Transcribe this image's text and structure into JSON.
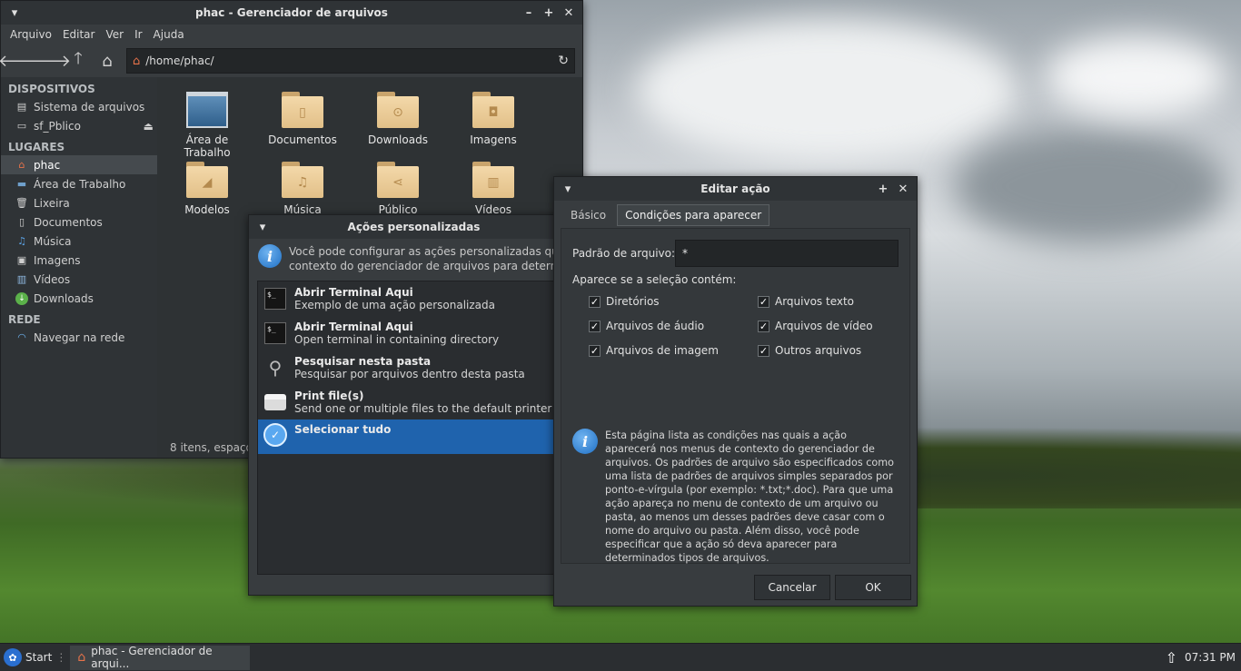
{
  "file_manager": {
    "title": "phac - Gerenciador de arquivos",
    "menu": [
      "Arquivo",
      "Editar",
      "Ver",
      "Ir",
      "Ajuda"
    ],
    "path": "/home/phac/",
    "sidebar": {
      "devices_header": "DISPOSITIVOS",
      "devices": [
        "Sistema de arquivos",
        "sf_Pblico"
      ],
      "places_header": "LUGARES",
      "places": [
        "phac",
        "Área de Trabalho",
        "Lixeira",
        "Documentos",
        "Música",
        "Imagens",
        "Vídeos",
        "Downloads"
      ],
      "network_header": "REDE",
      "network": [
        "Navegar na rede"
      ]
    },
    "items": [
      "Área de Trabalho",
      "Documentos",
      "Downloads",
      "Imagens",
      "Modelos",
      "Música",
      "Público",
      "Vídeos"
    ],
    "status": "8 itens, espaço l"
  },
  "custom_actions": {
    "title": "Ações personalizadas",
    "info_line1": "Você pode configurar as ações personalizadas que irão",
    "info_line2": "contexto do gerenciador de arquivos para determinad",
    "actions": [
      {
        "name": "Abrir Terminal Aqui",
        "desc": "Exemplo de uma ação personalizada",
        "icon": "terminal-icon"
      },
      {
        "name": "Abrir Terminal Aqui",
        "desc": "Open terminal in containing directory",
        "icon": "terminal-icon"
      },
      {
        "name": "Pesquisar nesta pasta",
        "desc": "Pesquisar por arquivos dentro desta pasta",
        "icon": "magnifier-icon"
      },
      {
        "name": "Print file(s)",
        "desc": "Send one or multiple files to the default printer",
        "icon": "printer-icon"
      },
      {
        "name": "Selecionar tudo",
        "desc": "",
        "icon": "check-icon"
      }
    ]
  },
  "edit_action": {
    "title": "Editar ação",
    "tab_basic": "Básico",
    "tab_conditions": "Condições para aparecer",
    "pattern_label": "Padrão de arquivo:",
    "pattern_value": "*",
    "appears_label": "Aparece se a seleção contém:",
    "checks": {
      "dirs": "Diretórios",
      "text": "Arquivos texto",
      "audio": "Arquivos de áudio",
      "video": "Arquivos de vídeo",
      "image": "Arquivos de imagem",
      "other": "Outros arquivos"
    },
    "info": "Esta página lista as condições nas quais a ação aparecerá nos menus de contexto do gerenciador de arquivos. Os padrões de arquivo são especificados como uma lista de padrões de arquivos simples separados por ponto-e-vírgula (por exemplo: *.txt;*.doc). Para que uma ação apareça no menu de contexto de um arquivo ou pasta, ao menos um desses padrões deve casar com o nome do arquivo ou pasta. Além disso, você pode especificar que a ação só deva aparecer para determinados tipos de arquivos.",
    "cancel": "Cancelar",
    "ok": "OK"
  },
  "taskbar": {
    "start": "Start",
    "task": "phac - Gerenciador de arqui...",
    "clock": "07:31 PM"
  }
}
